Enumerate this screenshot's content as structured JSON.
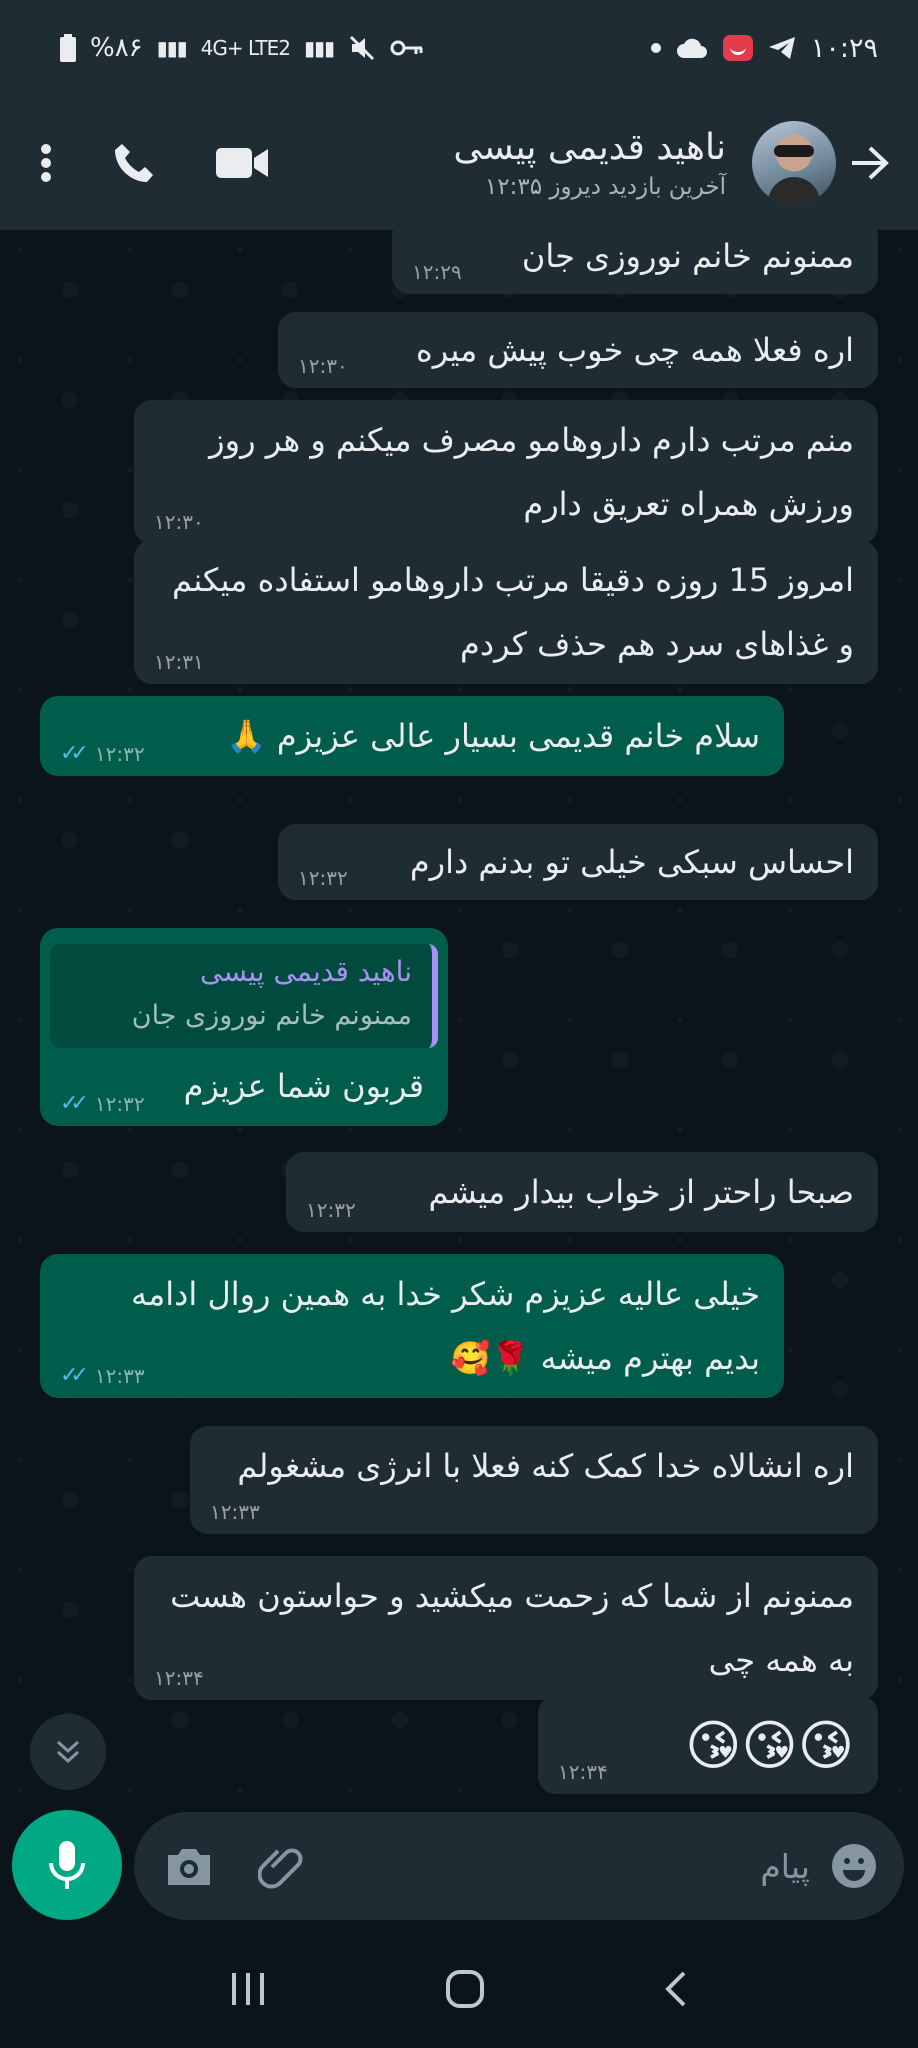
{
  "status": {
    "time": "۱۰:۲۹",
    "battery": "%۸۶",
    "network": "4G+ LTE2"
  },
  "header": {
    "contact_name": "ناهید قدیمی پیسی",
    "last_seen": "آخرین بازدید دیروز ۱۲:۳۵"
  },
  "messages": [
    {
      "dir": "in",
      "text": "ممنونم خانم نوروزی جان",
      "time": "۱۲:۲۹"
    },
    {
      "dir": "in",
      "text": "اره فعلا همه چی خوب پیش میره",
      "time": "۱۲:۳۰"
    },
    {
      "dir": "in",
      "text": "منم مرتب دارم داروهامو مصرف میکنم و هر روز ورزش همراه تعریق دارم",
      "time": "۱۲:۳۰"
    },
    {
      "dir": "in",
      "text": "امروز 15 روزه دقیقا مرتب داروهامو استفاده میکنم و غذاهای سرد هم حذف کردم",
      "time": "۱۲:۳۱"
    },
    {
      "dir": "out",
      "text": "سلام خانم قدیمی بسیار عالی عزیزم 🙏",
      "time": "۱۲:۳۲"
    },
    {
      "dir": "in",
      "text": "احساس سبکی خیلی تو بدنم دارم",
      "time": "۱۲:۳۲"
    },
    {
      "dir": "out",
      "quote_name": "ناهید قدیمی پیسی",
      "quote_text": "ممنونم خانم نوروزی جان",
      "text": "قربون شما عزیزم",
      "time": "۱۲:۳۲"
    },
    {
      "dir": "in",
      "text": "صبحا راحتر از خواب بیدار میشم",
      "time": "۱۲:۳۲"
    },
    {
      "dir": "out",
      "text": "خیلی عالیه عزیزم شکر خدا به همین روال ادامه بدیم بهترم میشه 🌹🥰",
      "time": "۱۲:۳۳"
    },
    {
      "dir": "in",
      "text": "اره انشالاه خدا کمک کنه فعلا با انرژی مشغولم",
      "time": "۱۲:۳۳"
    },
    {
      "dir": "in",
      "text": "ممنونم از شما که زحمت میکشید و حواستون هست به همه چی",
      "time": "۱۲:۳۴"
    },
    {
      "dir": "in",
      "text": "😘😘😘",
      "time": "۱۲:۳۴"
    }
  ],
  "input": {
    "placeholder": "پیام"
  },
  "colors": {
    "incoming": "#202c33",
    "outgoing": "#005c4b",
    "accent": "#00a884",
    "read_ticks": "#53bdeb"
  }
}
